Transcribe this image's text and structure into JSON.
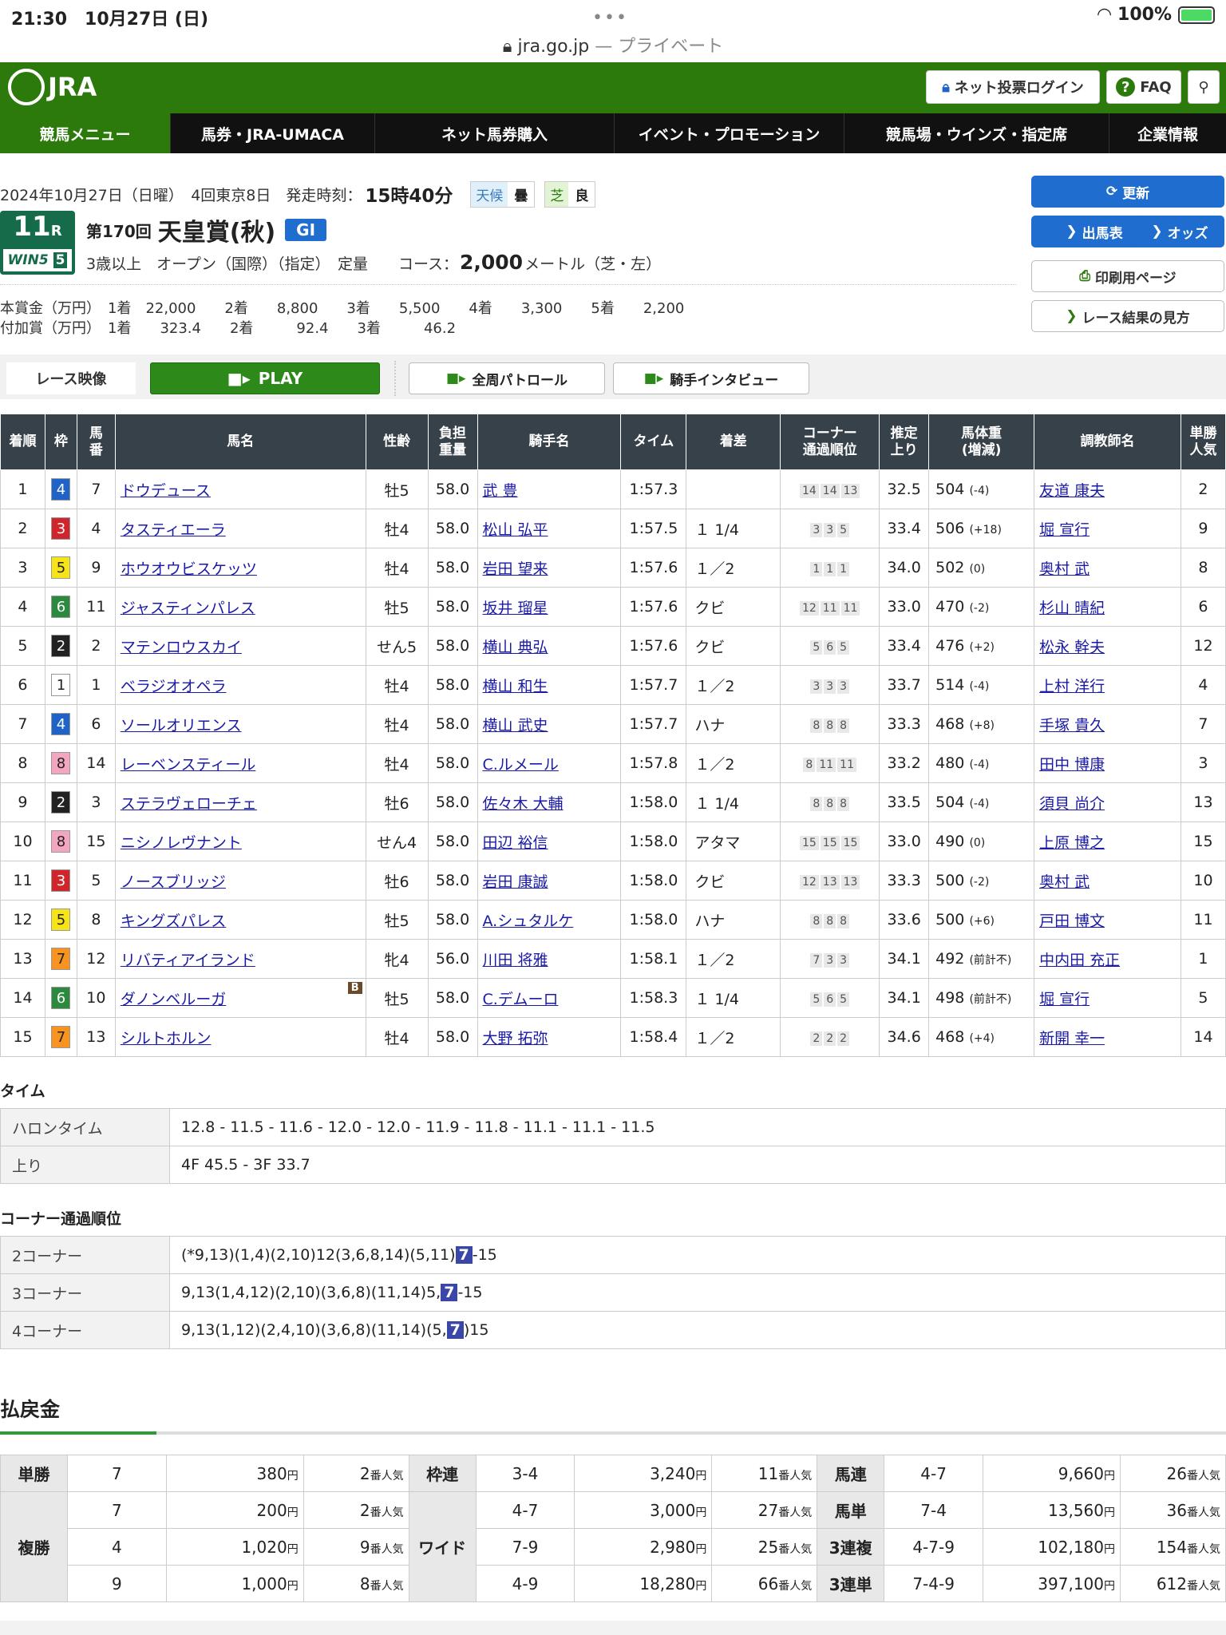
{
  "status": {
    "time": "21:30　10月27日 (日)",
    "battery": "100%"
  },
  "url": {
    "domain": "jra.go.jp",
    "private": " — プライベート"
  },
  "header": {
    "logo": "JRA",
    "login": "ネット投票ログイン",
    "faq": "FAQ"
  },
  "nav": [
    "競馬メニュー",
    "馬券・JRA-UMACA",
    "ネット馬券購入",
    "イベント・プロモーション",
    "競馬場・ウインズ・指定席",
    "企業情報"
  ],
  "race": {
    "date": "2024年10月27日（日曜）　4回東京8日　発走時刻：",
    "start_time": "15時40分",
    "weather_label": "天候",
    "weather": "曇",
    "track_label": "芝",
    "track_cond": "良",
    "race_no": "11",
    "race_r": "R",
    "win5": "WIN5",
    "win5_no": "5",
    "title_prefix": "第170回",
    "title": "天皇賞(秋)",
    "grade": "GI",
    "conditions": "3歳以上　オープン（国際）（指定）　定量　　コース：",
    "distance": "2,000",
    "distance_unit": "メートル（芝・左）",
    "prize": "本賞金（万円）　1着　22,000　　2着　　8,800　　3着　　5,500　　4着　　3,300　　5着　　2,200",
    "add_prize": "付加賞（万円）　1着　　323.4　　2着　　　92.4　　3着　　　46.2"
  },
  "buttons": {
    "refresh": "更新",
    "entries": "出馬表",
    "odds": "オッズ",
    "print": "印刷用ページ",
    "guide": "レース結果の見方"
  },
  "video": {
    "label": "レース映像",
    "play": "PLAY",
    "patrol": "全周パトロール",
    "interview": "騎手インタビュー"
  },
  "results_headers": [
    "着順",
    "枠",
    "馬\n番",
    "馬名",
    "性齢",
    "負担\n重量",
    "騎手名",
    "タイム",
    "着差",
    "コーナー\n通過順位",
    "推定\n上り",
    "馬体重\n(増減)",
    "調教師名",
    "単勝\n人気"
  ],
  "results": [
    {
      "pos": "1",
      "waku": "4",
      "num": "7",
      "horse": "ドウデュース",
      "sex": "牡5",
      "wt": "58.0",
      "jockey": "武 豊",
      "time": "1:57.3",
      "margin": "",
      "corners": [
        "14",
        "14",
        "13"
      ],
      "agari": "32.5",
      "bw": "504",
      "bwd": "(-4)",
      "trainer": "友道 康夫",
      "pop": "2"
    },
    {
      "pos": "2",
      "waku": "3",
      "num": "4",
      "horse": "タスティエーラ",
      "sex": "牡4",
      "wt": "58.0",
      "jockey": "松山 弘平",
      "time": "1:57.5",
      "margin": "１ 1/4",
      "corners": [
        "3",
        "3",
        "5"
      ],
      "agari": "33.4",
      "bw": "506",
      "bwd": "(+18)",
      "trainer": "堀 宣行",
      "pop": "9"
    },
    {
      "pos": "3",
      "waku": "5",
      "num": "9",
      "horse": "ホウオウビスケッツ",
      "sex": "牡4",
      "wt": "58.0",
      "jockey": "岩田 望来",
      "time": "1:57.6",
      "margin": "１／2",
      "corners": [
        "1",
        "1",
        "1"
      ],
      "agari": "34.0",
      "bw": "502",
      "bwd": "(0)",
      "trainer": "奥村 武",
      "pop": "8"
    },
    {
      "pos": "4",
      "waku": "6",
      "num": "11",
      "horse": "ジャスティンパレス",
      "sex": "牡5",
      "wt": "58.0",
      "jockey": "坂井 瑠星",
      "time": "1:57.6",
      "margin": "クビ",
      "corners": [
        "12",
        "11",
        "11"
      ],
      "agari": "33.0",
      "bw": "470",
      "bwd": "(-2)",
      "trainer": "杉山 晴紀",
      "pop": "6"
    },
    {
      "pos": "5",
      "waku": "2",
      "num": "2",
      "horse": "マテンロウスカイ",
      "sex": "せん5",
      "wt": "58.0",
      "jockey": "横山 典弘",
      "time": "1:57.6",
      "margin": "クビ",
      "corners": [
        "5",
        "6",
        "5"
      ],
      "agari": "33.4",
      "bw": "476",
      "bwd": "(+2)",
      "trainer": "松永 幹夫",
      "pop": "12"
    },
    {
      "pos": "6",
      "waku": "1",
      "num": "1",
      "horse": "ベラジオオペラ",
      "sex": "牡4",
      "wt": "58.0",
      "jockey": "横山 和生",
      "time": "1:57.7",
      "margin": "１／2",
      "corners": [
        "3",
        "3",
        "3"
      ],
      "agari": "33.7",
      "bw": "514",
      "bwd": "(-4)",
      "trainer": "上村 洋行",
      "pop": "4"
    },
    {
      "pos": "7",
      "waku": "4",
      "num": "6",
      "horse": "ソールオリエンス",
      "sex": "牡4",
      "wt": "58.0",
      "jockey": "横山 武史",
      "time": "1:57.7",
      "margin": "ハナ",
      "corners": [
        "8",
        "8",
        "8"
      ],
      "agari": "33.3",
      "bw": "468",
      "bwd": "(+8)",
      "trainer": "手塚 貴久",
      "pop": "7"
    },
    {
      "pos": "8",
      "waku": "8",
      "num": "14",
      "horse": "レーベンスティール",
      "sex": "牡4",
      "wt": "58.0",
      "jockey": "C.ルメール",
      "time": "1:57.8",
      "margin": "１／2",
      "corners": [
        "8",
        "11",
        "11"
      ],
      "agari": "33.2",
      "bw": "480",
      "bwd": "(-4)",
      "trainer": "田中 博康",
      "pop": "3"
    },
    {
      "pos": "9",
      "waku": "2",
      "num": "3",
      "horse": "ステラヴェローチェ",
      "sex": "牡6",
      "wt": "58.0",
      "jockey": "佐々木 大輔",
      "time": "1:58.0",
      "margin": "１ 1/4",
      "corners": [
        "8",
        "8",
        "8"
      ],
      "agari": "33.5",
      "bw": "504",
      "bwd": "(-4)",
      "trainer": "須貝 尚介",
      "pop": "13"
    },
    {
      "pos": "10",
      "waku": "8",
      "num": "15",
      "horse": "ニシノレヴナント",
      "sex": "せん4",
      "wt": "58.0",
      "jockey": "田辺 裕信",
      "time": "1:58.0",
      "margin": "アタマ",
      "corners": [
        "15",
        "15",
        "15"
      ],
      "agari": "33.0",
      "bw": "490",
      "bwd": "(0)",
      "trainer": "上原 博之",
      "pop": "15"
    },
    {
      "pos": "11",
      "waku": "3",
      "num": "5",
      "horse": "ノースブリッジ",
      "sex": "牡6",
      "wt": "58.0",
      "jockey": "岩田 康誠",
      "time": "1:58.0",
      "margin": "クビ",
      "corners": [
        "12",
        "13",
        "13"
      ],
      "agari": "33.3",
      "bw": "500",
      "bwd": "(-2)",
      "trainer": "奥村 武",
      "pop": "10"
    },
    {
      "pos": "12",
      "waku": "5",
      "num": "8",
      "horse": "キングズパレス",
      "sex": "牡5",
      "wt": "58.0",
      "jockey": "A.シュタルケ",
      "time": "1:58.0",
      "margin": "ハナ",
      "corners": [
        "8",
        "8",
        "8"
      ],
      "agari": "33.6",
      "bw": "500",
      "bwd": "(+6)",
      "trainer": "戸田 博文",
      "pop": "11"
    },
    {
      "pos": "13",
      "waku": "7",
      "num": "12",
      "horse": "リバティアイランド",
      "sex": "牝4",
      "wt": "56.0",
      "jockey": "川田 将雅",
      "time": "1:58.1",
      "margin": "１／2",
      "corners": [
        "7",
        "3",
        "3"
      ],
      "agari": "34.1",
      "bw": "492",
      "bwd": "(前計不)",
      "trainer": "中内田 充正",
      "pop": "1"
    },
    {
      "pos": "14",
      "waku": "6",
      "num": "10",
      "horse": "ダノンベルーガ",
      "blinker": "B",
      "sex": "牡5",
      "wt": "58.0",
      "jockey": "C.デムーロ",
      "time": "1:58.3",
      "margin": "１ 1/4",
      "corners": [
        "5",
        "6",
        "5"
      ],
      "agari": "34.1",
      "bw": "498",
      "bwd": "(前計不)",
      "trainer": "堀 宣行",
      "pop": "5"
    },
    {
      "pos": "15",
      "waku": "7",
      "num": "13",
      "horse": "シルトホルン",
      "sex": "牡4",
      "wt": "58.0",
      "jockey": "大野 拓弥",
      "time": "1:58.4",
      "margin": "１／2",
      "corners": [
        "2",
        "2",
        "2"
      ],
      "agari": "34.6",
      "bw": "468",
      "bwd": "(+4)",
      "trainer": "新開 幸一",
      "pop": "14"
    }
  ],
  "waku_colors": {
    "1": "#ffffff",
    "2": "#222222",
    "3": "#d0262b",
    "4": "#1f63c9",
    "5": "#f7e418",
    "6": "#2b8a3e",
    "7": "#f7931e",
    "8": "#f4a6c0"
  },
  "time": {
    "title": "タイム",
    "furlong_label": "ハロンタイム",
    "furlong": "12.8 - 11.5 - 11.6 - 12.0 - 12.0 - 11.9 - 11.8 - 11.1 - 11.1 - 11.5",
    "agari_label": "上り",
    "agari": "4F 45.5 - 3F 33.7"
  },
  "corners": {
    "title": "コーナー通過順位",
    "rows": [
      {
        "label": "2コーナー",
        "before": "(*9,13)(1,4)(2,10)12(3,6,8,14)(5,11)",
        "hl": "7",
        "after": "-15"
      },
      {
        "label": "3コーナー",
        "before": "9,13(1,4,12)(2,10)(3,6,8)(11,14)5,",
        "hl": "7",
        "after": "-15"
      },
      {
        "label": "4コーナー",
        "before": "9,13(1,12)(2,4,10)(3,6,8)(11,14)(5,",
        "hl": "7",
        "after": ")15"
      }
    ]
  },
  "payout": {
    "title": "払戻金",
    "yen": "円",
    "pop_suffix": "番人気",
    "tansho": {
      "label": "単勝",
      "rows": [
        {
          "combo": "7",
          "amount": "380",
          "pop": "2"
        }
      ]
    },
    "fukusho": {
      "label": "複勝",
      "rows": [
        {
          "combo": "7",
          "amount": "200",
          "pop": "2"
        },
        {
          "combo": "4",
          "amount": "1,020",
          "pop": "9"
        },
        {
          "combo": "9",
          "amount": "1,000",
          "pop": "8"
        }
      ]
    },
    "wakuren": {
      "label": "枠連",
      "rows": [
        {
          "combo": "3-4",
          "amount": "3,240",
          "pop": "11"
        }
      ]
    },
    "wide": {
      "label": "ワイド",
      "rows": [
        {
          "combo": "4-7",
          "amount": "3,000",
          "pop": "27"
        },
        {
          "combo": "7-9",
          "amount": "2,980",
          "pop": "25"
        },
        {
          "combo": "4-9",
          "amount": "18,280",
          "pop": "66"
        }
      ]
    },
    "umaren": {
      "label": "馬連",
      "rows": [
        {
          "combo": "4-7",
          "amount": "9,660",
          "pop": "26"
        }
      ]
    },
    "umatan": {
      "label": "馬単",
      "rows": [
        {
          "combo": "7-4",
          "amount": "13,560",
          "pop": "36"
        }
      ]
    },
    "sanrenpuku": {
      "label": "3連複",
      "rows": [
        {
          "combo": "4-7-9",
          "amount": "102,180",
          "pop": "154"
        }
      ]
    },
    "sanrentan": {
      "label": "3連単",
      "rows": [
        {
          "combo": "7-4-9",
          "amount": "397,100",
          "pop": "612"
        }
      ]
    }
  }
}
